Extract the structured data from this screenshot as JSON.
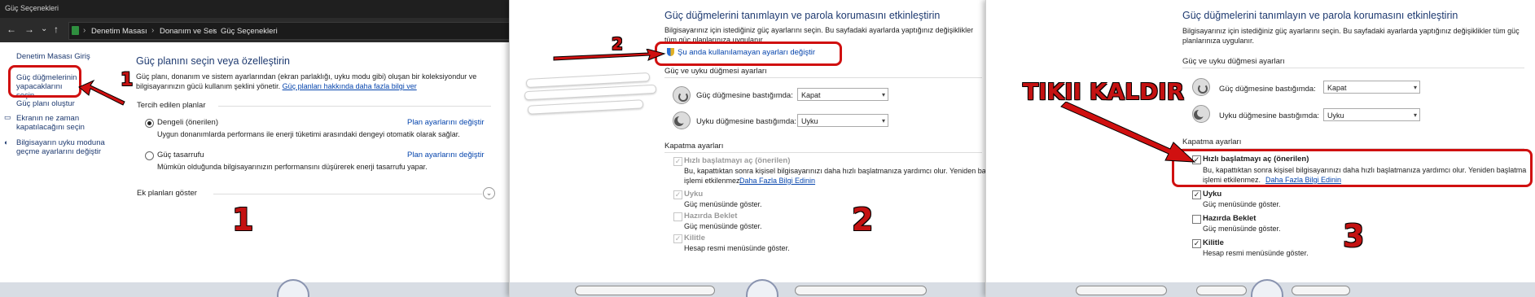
{
  "window": {
    "title": "Güç Seçenekleri"
  },
  "nav": {
    "back": "←",
    "forward": "→",
    "recent": "⌄",
    "up": "↑",
    "breadcrumbs": [
      "Denetim Masası",
      "Donanım ve Ses",
      "Güç Seçenekleri"
    ],
    "separator": "›"
  },
  "p1": {
    "sidebar": {
      "home": "Denetim Masası Giriş",
      "items": [
        "Güç düğmelerinin yapacaklarını seçin",
        "Güç planı oluştur",
        "Ekranın ne zaman kapatılacağını seçin",
        "Bilgisayarın uyku moduna geçme ayarlarını değiştir"
      ]
    },
    "heading": "Güç planını seçin veya özelleştirin",
    "intro": "Güç planı, donanım ve sistem ayarlarından (ekran parlaklığı, uyku modu gibi) oluşan bir koleksiyondur ve bilgisayarınızın gücü kullanım şeklini yönetir.",
    "intro_link": "Güç planları hakkında daha fazla bilgi ver",
    "preferred_label": "Tercih edilen planlar",
    "plans": [
      {
        "name": "Dengeli (önerilen)",
        "desc": "Uygun donanımlarda performans ile enerji tüketimi arasındaki dengeyi otomatik olarak sağlar.",
        "change": "Plan ayarlarını değiştir",
        "selected": true
      },
      {
        "name": "Güç tasarrufu",
        "desc": "Mümkün olduğunda bilgisayarınızın performansını düşürerek enerji tasarrufu yapar.",
        "change": "Plan ayarlarını değiştir",
        "selected": false
      }
    ],
    "extra_plans": "Ek planları göster",
    "expand_icon": "⌄",
    "step": "1"
  },
  "p2": {
    "heading": "Güç düğmelerini tanımlayın ve parola korumasını etkinleştirin",
    "intro": "Bilgisayarınız için istediğiniz güç ayarlarını seçin. Bu sayfadaki ayarlarda yaptığınız değişiklikler tüm güç planlarınıza uygulanır.",
    "change_link": "Şu anda kullanılamayan ayarları değiştir",
    "buttons_section": "Güç ve uyku düğmesi ayarları",
    "power_label": "Güç düğmesine bastığımda:",
    "power_value": "Kapat",
    "sleep_label": "Uyku düğmesine bastığımda:",
    "sleep_value": "Uyku",
    "shutdown_section": "Kapatma ayarları",
    "options": [
      {
        "title": "Hızlı başlatmayı aç (önerilen)",
        "desc1": "Bu, kapattıktan sonra kişisel bilgisayarınızı daha hızlı başlatmanıza yardımcı olur. Yeniden başlatma",
        "desc2": "işlemi etkilenmez.",
        "link": "Daha Fazla Bilgi Edinin",
        "checked": true
      },
      {
        "title": "Uyku",
        "desc1": "Güç menüsünde göster.",
        "checked": true
      },
      {
        "title": "Hazırda Beklet",
        "desc1": "Güç menüsünde göster.",
        "checked": false
      },
      {
        "title": "Kilitle",
        "desc1": "Hesap resmi menüsünde göster.",
        "checked": true
      }
    ],
    "step": "2",
    "arrow_step": "2"
  },
  "p3": {
    "heading": "Güç düğmelerini tanımlayın ve parola korumasını etkinleştirin",
    "intro": "Bilgisayarınız için istediğiniz güç ayarlarını seçin. Bu sayfadaki ayarlarda yaptığınız değişiklikler tüm güç planlarınıza uygulanır.",
    "buttons_section": "Güç ve uyku düğmesi ayarları",
    "power_label": "Güç düğmesine bastığımda:",
    "power_value": "Kapat",
    "sleep_label": "Uyku düğmesine bastığımda:",
    "sleep_value": "Uyku",
    "shutdown_section": "Kapatma ayarları",
    "options": [
      {
        "title": "Hızlı başlatmayı aç (önerilen)",
        "desc1": "Bu, kapattıktan sonra kişisel bilgisayarınızı daha hızlı başlatmanıza yardımcı olur. Yeniden başlatma",
        "desc2": "işlemi etkilenmez.",
        "link": "Daha Fazla Bilgi Edinin",
        "checked": true
      },
      {
        "title": "Uyku",
        "desc1": "Güç menüsünde göster.",
        "checked": true
      },
      {
        "title": "Hazırda Beklet",
        "desc1": "Güç menüsünde göster.",
        "checked": false
      },
      {
        "title": "Kilitle",
        "desc1": "Hesap resmi menüsünde göster.",
        "checked": true
      }
    ],
    "callout": "TIKII KALDIR",
    "step": "3"
  },
  "colors": {
    "annotation_red": "#d01010",
    "heading_blue": "#1e3a70",
    "link_blue": "#0645ad"
  }
}
